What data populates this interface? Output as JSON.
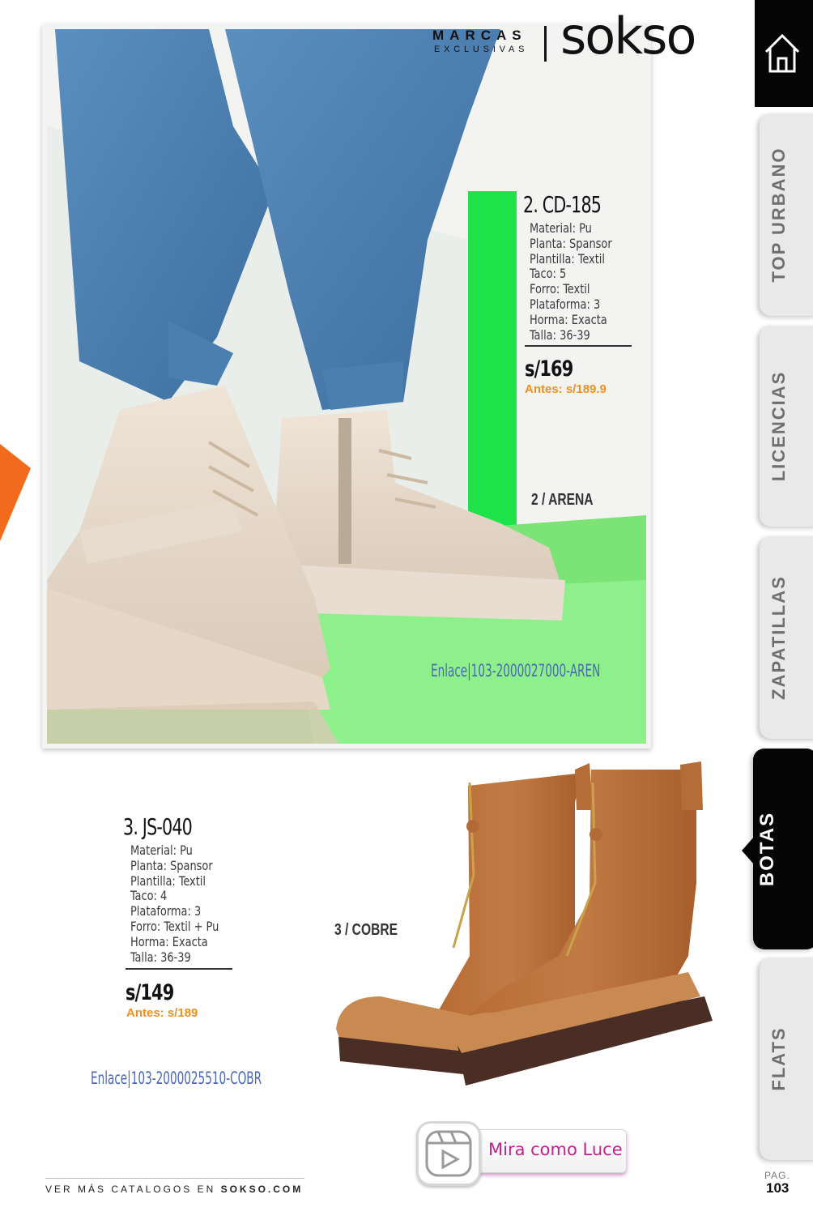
{
  "brand": {
    "line1": "MARCAS",
    "line2": "EXCLUSIVAS",
    "logo": "sokso"
  },
  "product_2": {
    "code": "2. CD-185",
    "specs": [
      "Material: Pu",
      "Planta: Spansor",
      "Plantilla: Textil",
      "Taco: 5",
      "Forro: Textil",
      "Plataforma: 3",
      "Horma: Exacta",
      "Talla: 36-39"
    ],
    "price": "s/169",
    "before": "Antes: s/189.9",
    "color": "2 / ARENA",
    "link": "Enlace|103-2000027000-AREN"
  },
  "product_3": {
    "code": "3. JS-040",
    "specs": [
      "Material: Pu",
      "Planta: Spansor",
      "Plantilla: Textil",
      "Taco: 4",
      "Plataforma: 3",
      "Forro: Textil + Pu",
      "Horma: Exacta",
      "Talla: 36-39"
    ],
    "price": "s/149",
    "before": "Antes: s/189",
    "color": "3 / COBRE",
    "link": "Enlace|103-2000025510-COBR"
  },
  "nav": {
    "home_icon": "home-icon",
    "tabs": [
      "TOP URBANO",
      "LICENCIAS",
      "ZAPATILLAS",
      "BOTAS",
      "FLATS"
    ],
    "active": "BOTAS"
  },
  "video_button": {
    "label": "Mira como Luce",
    "icon": "play-reel-icon"
  },
  "footer": {
    "text": "VER MÁS CATALOGOS EN ",
    "site": "SOKSO.COM",
    "page_label": "PAG.",
    "page_number": "103"
  },
  "colors": {
    "accent_price_before": "#f0901e",
    "link": "#4a68b8",
    "video_text": "#c2238c",
    "active_tab": "#050505"
  }
}
